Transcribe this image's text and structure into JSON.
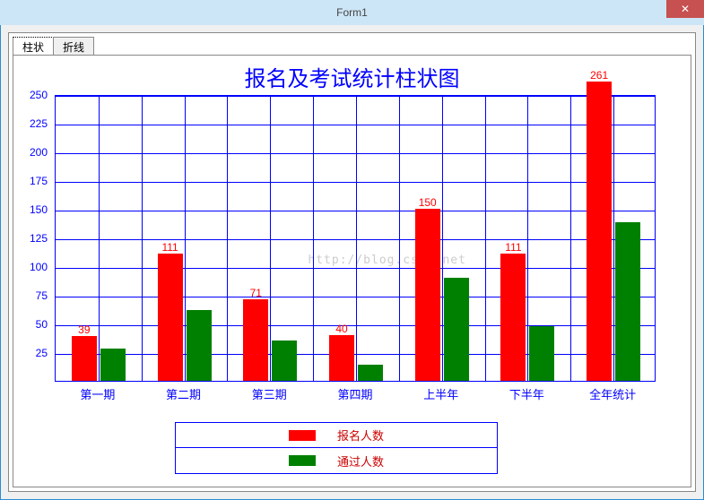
{
  "window": {
    "title": "Form1",
    "close_glyph": "✕"
  },
  "tabs": [
    {
      "label": "柱状",
      "active": true
    },
    {
      "label": "折线",
      "active": false
    }
  ],
  "chart_data": {
    "type": "bar",
    "title": "报名及考试统计柱状图",
    "categories": [
      "第一期",
      "第二期",
      "第三期",
      "第四期",
      "上半年",
      "下半年",
      "全年统计"
    ],
    "series": [
      {
        "name": "报名人数",
        "color": "#ff0000",
        "values": [
          39,
          111,
          71,
          40,
          150,
          111,
          261
        ]
      },
      {
        "name": "通过人数",
        "color": "#008000",
        "values": [
          28,
          62,
          35,
          14,
          90,
          48,
          138
        ]
      }
    ],
    "ylim": [
      0,
      250
    ],
    "yticks": [
      25,
      50,
      75,
      100,
      125,
      150,
      175,
      200,
      225,
      250
    ],
    "xlabel": "",
    "ylabel": "",
    "watermark": "http://blog.csdn.net"
  },
  "legend": {
    "entries": [
      {
        "key": "报名人数",
        "color": "red"
      },
      {
        "key": "通过人数",
        "color": "green"
      }
    ]
  }
}
